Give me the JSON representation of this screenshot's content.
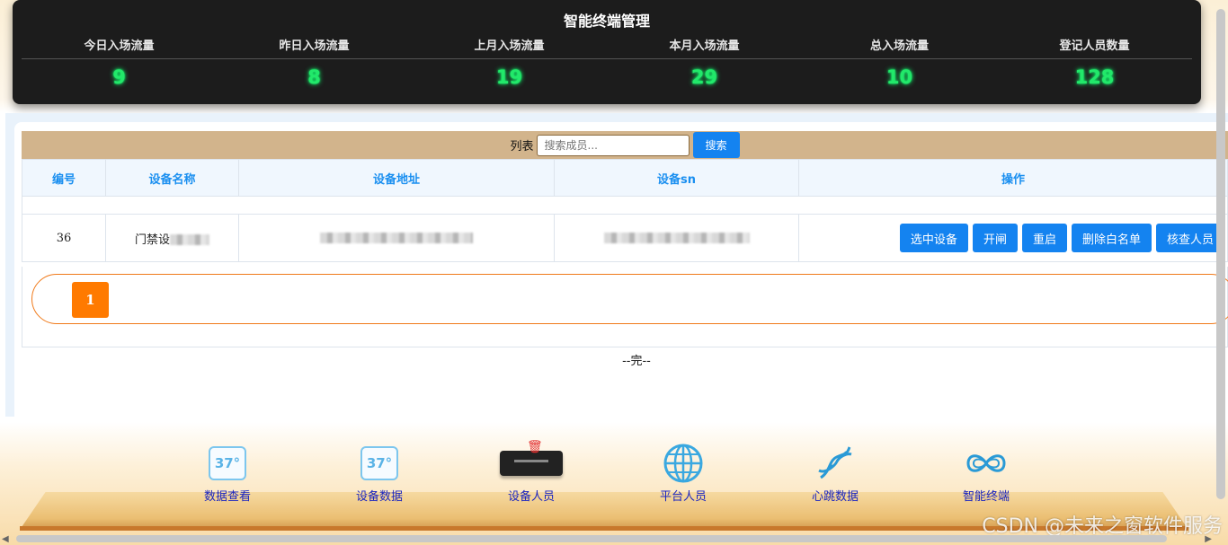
{
  "stats": {
    "title": "智能终端管理",
    "items": [
      {
        "label": "今日入场流量",
        "value": "9"
      },
      {
        "label": "昨日入场流量",
        "value": "8"
      },
      {
        "label": "上月入场流量",
        "value": "19"
      },
      {
        "label": "本月入场流量",
        "value": "29"
      },
      {
        "label": "总入场流量",
        "value": "10"
      },
      {
        "label": "登记人员数量",
        "value": "128"
      }
    ]
  },
  "toolbar": {
    "list_label": "列表",
    "search_placeholder": "搜索成员...",
    "search_button": "搜索"
  },
  "table": {
    "headers": [
      "编号",
      "设备名称",
      "设备地址",
      "设备sn",
      "操作"
    ],
    "rows": [
      {
        "id": "36",
        "name": "门禁设"
      }
    ],
    "actions": [
      "选中设备",
      "开闸",
      "重启",
      "删除白名单",
      "核查人员"
    ]
  },
  "pagination": {
    "current_page": "1"
  },
  "end_text": "--完--",
  "bottom_nav": [
    {
      "label": "数据查看",
      "icon": "thermometer-37-icon"
    },
    {
      "label": "设备数据",
      "icon": "thermometer-37-icon"
    },
    {
      "label": "设备人员",
      "icon": "terminal-device-icon"
    },
    {
      "label": "平台人员",
      "icon": "globe-icon"
    },
    {
      "label": "心跳数据",
      "icon": "dna-icon"
    },
    {
      "label": "智能终端",
      "icon": "infinity-icon"
    }
  ],
  "icon_text": {
    "thermo": "37°"
  },
  "watermark": "CSDN @未来之窗软件服务",
  "colors": {
    "accent": "#1483f0",
    "stat_value": "#22e86a",
    "page_active": "#ff7a00",
    "toolbar_bg": "#d2b48c"
  }
}
